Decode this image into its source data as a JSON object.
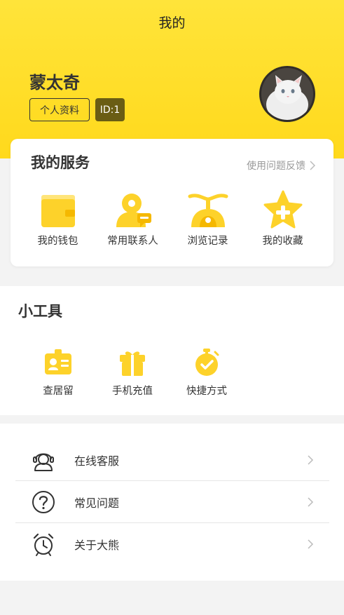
{
  "header": {
    "title": "我的"
  },
  "profile": {
    "nickname": "蒙太奇",
    "profile_button": "个人资料",
    "id_label": "ID:1"
  },
  "services": {
    "title": "我的服务",
    "feedback": "使用问题反馈",
    "items": [
      {
        "label": "我的钱包",
        "icon": "wallet-icon"
      },
      {
        "label": "常用联系人",
        "icon": "contacts-icon"
      },
      {
        "label": "浏览记录",
        "icon": "history-icon"
      },
      {
        "label": "我的收藏",
        "icon": "favorite-star-icon"
      }
    ]
  },
  "tools": {
    "title": "小工具",
    "items": [
      {
        "label": "查居留",
        "icon": "id-card-icon"
      },
      {
        "label": "手机充值",
        "icon": "gift-icon"
      },
      {
        "label": "快捷方式",
        "icon": "stopwatch-icon"
      }
    ]
  },
  "menu": [
    {
      "label": "在线客服",
      "icon": "customer-service-icon"
    },
    {
      "label": "常见问题",
      "icon": "question-icon"
    },
    {
      "label": "关于大熊",
      "icon": "alarm-clock-icon"
    }
  ],
  "colors": {
    "accent": "#ffd91c",
    "icon_yellow": "#fdd22a",
    "badge": "#6a5d14"
  }
}
